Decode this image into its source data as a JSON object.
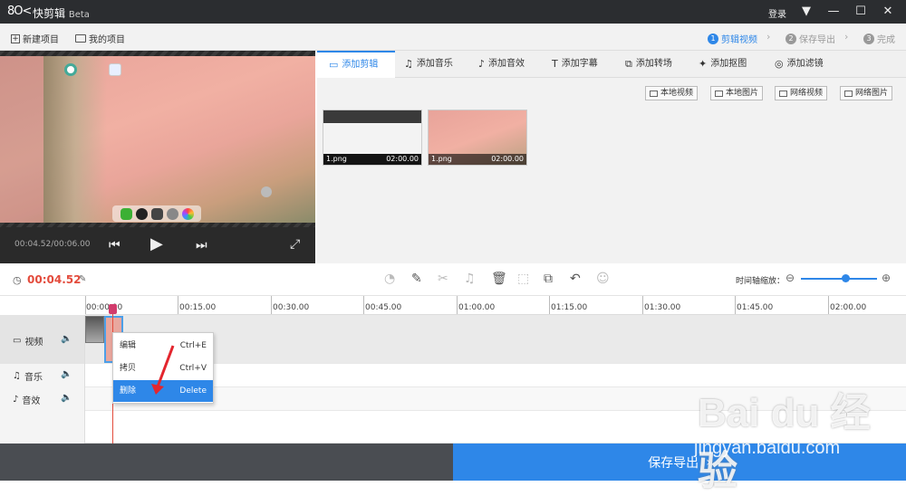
{
  "titlebar": {
    "logo": "8O<",
    "title": "快剪辑",
    "beta": "Beta",
    "login": "登录",
    "menu_icon": "▼",
    "min_icon": "—",
    "max_icon": "☐",
    "close_icon": "✕"
  },
  "menubar": {
    "new_project": "新建项目",
    "my_projects": "我的项目",
    "steps": [
      {
        "num": "1",
        "label": "剪辑视频"
      },
      {
        "num": "2",
        "label": "保存导出"
      },
      {
        "num": "3",
        "label": "完成"
      }
    ]
  },
  "preview": {
    "time": "00:04.52/00:06.00"
  },
  "tabs": [
    {
      "label": "添加剪辑",
      "icon": "video-icon"
    },
    {
      "label": "添加音乐",
      "icon": "music-icon"
    },
    {
      "label": "添加音效",
      "icon": "sound-effect-icon"
    },
    {
      "label": "添加字幕",
      "icon": "subtitle-icon"
    },
    {
      "label": "添加转场",
      "icon": "transition-icon"
    },
    {
      "label": "添加抠图",
      "icon": "cutout-icon"
    },
    {
      "label": "添加滤镜",
      "icon": "filter-icon"
    }
  ],
  "sources": [
    "本地视频",
    "本地图片",
    "网络视频",
    "网络图片"
  ],
  "media": [
    {
      "name": "1.png",
      "duration": "02:00.00"
    },
    {
      "name": "1.png",
      "duration": "02:00.00"
    }
  ],
  "toolbar": {
    "current_time": "00:04.52",
    "zoom_label": "时间轴缩放："
  },
  "ruler": [
    "00:00.00",
    "00:15.00",
    "00:30.00",
    "00:45.00",
    "01:00.00",
    "01:15.00",
    "01:30.00",
    "01:45.00",
    "02:00.00"
  ],
  "tracks": {
    "video": "视频",
    "music": "音乐",
    "sfx": "音效"
  },
  "context_menu": [
    {
      "label": "编辑",
      "shortcut": "Ctrl+E"
    },
    {
      "label": "拷贝",
      "shortcut": "Ctrl+V"
    },
    {
      "label": "删除",
      "shortcut": "Delete"
    }
  ],
  "export": {
    "label": "保存导出",
    "icon": "chevron-right-icon"
  },
  "watermark": {
    "line1": "Bai du 经验",
    "line2": "jingyan.baidu.com"
  },
  "colors": {
    "accent": "#2e87e8",
    "time_red": "#e34b3c",
    "title_bg": "#2b2d30"
  }
}
